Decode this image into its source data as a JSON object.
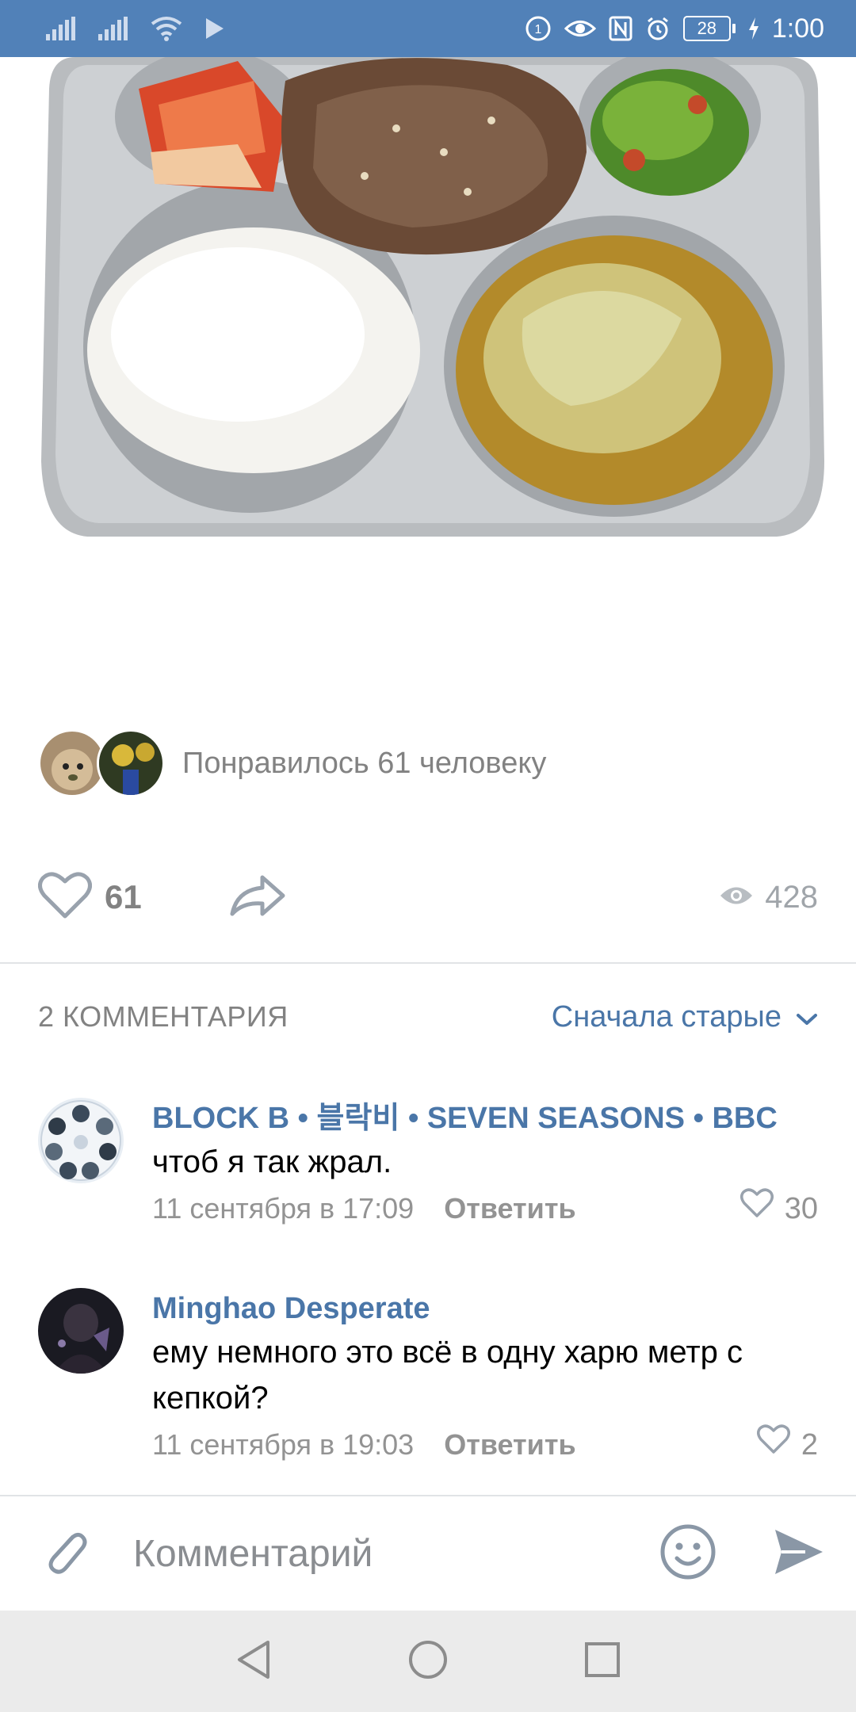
{
  "status_bar": {
    "battery": "28",
    "time": "1:00"
  },
  "post": {
    "image_label": "food-tray-photo",
    "likers_text": "Понравилось 61 человеку",
    "like_count": "61",
    "views_count": "428"
  },
  "comments_section": {
    "count_label": "2 КОММЕНТАРИЯ",
    "sort_label": "Сначала старые"
  },
  "comments": [
    {
      "author": "BLOCK B • 블락비 • SEVEN SEASONS • BBC",
      "text": "чтоб я так жрал.",
      "date": "11 сентября в 17:09",
      "reply": "Ответить",
      "likes": "30"
    },
    {
      "author": "Minghao Desperate",
      "text": "ему немного это всё в одну харю метр с кепкой?",
      "date": "11 сентября в 19:03",
      "reply": "Ответить",
      "likes": "2"
    }
  ],
  "input": {
    "placeholder": "Комментарий"
  },
  "colors": {
    "status_bar": "#5181b8",
    "link": "#4a76a8",
    "muted": "#828282"
  }
}
